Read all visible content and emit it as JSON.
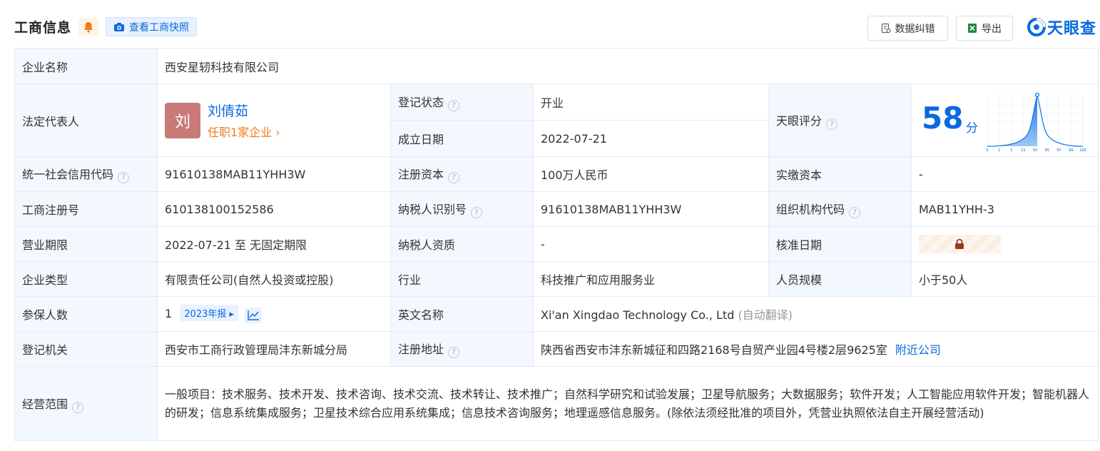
{
  "header": {
    "title": "工商信息",
    "snapshot_label": "查看工商快照",
    "correct_label": "数据纠错",
    "export_label": "导出",
    "logo_text": "天眼查"
  },
  "labels": {
    "company_name": "企业名称",
    "legal_rep": "法定代表人",
    "reg_status": "登记状态",
    "found_date": "成立日期",
    "tianyan_score": "天眼评分",
    "credit_code": "统一社会信用代码",
    "reg_capital": "注册资本",
    "paid_capital": "实缴资本",
    "reg_number": "工商注册号",
    "taxpayer_id": "纳税人识别号",
    "org_code": "组织机构代码",
    "term": "营业期限",
    "taxpayer_quality": "纳税人资质",
    "approval_date": "核准日期",
    "company_type": "企业类型",
    "industry": "行业",
    "staff_size": "人员规模",
    "insured_count": "参保人数",
    "english_name": "英文名称",
    "reg_authority": "登记机关",
    "reg_address": "注册地址",
    "business_scope": "经营范围"
  },
  "values": {
    "company_name": "西安星轫科技有限公司",
    "rep_avatar": "刘",
    "rep_name": "刘倩茹",
    "rep_sub": "任职1家企业",
    "reg_status": "开业",
    "found_date": "2022-07-21",
    "score": "58",
    "score_unit": "分",
    "credit_code": "91610138MAB11YHH3W",
    "reg_capital": "100万人民币",
    "paid_capital": "-",
    "reg_number": "610138100152586",
    "taxpayer_id": "91610138MAB11YHH3W",
    "org_code": "MAB11YHH-3",
    "term": "2022-07-21 至 无固定期限",
    "taxpayer_quality": "-",
    "company_type": "有限责任公司(自然人投资或控股)",
    "industry": "科技推广和应用服务业",
    "staff_size": "小于50人",
    "insured_count": "1",
    "insured_report": "2023年报",
    "english_name": "Xi'an Xingdao Technology Co., Ltd",
    "english_note": "(自动翻译)",
    "reg_authority": "西安市工商行政管理局沣东新城分局",
    "reg_address": "陕西省西安市沣东新城征和四路2168号自贸产业园4号楼2层9625室",
    "nearby_link": "附近公司",
    "business_scope": "一般项目：技术服务、技术开发、技术咨询、技术交流、技术转让、技术推广；自然科学研究和试验发展；卫星导航服务；大数据服务；软件开发；人工智能应用软件开发；智能机器人的研发；信息系统集成服务；卫星技术综合应用系统集成；信息技术咨询服务；地理遥感信息服务。(除依法须经批准的项目外，凭营业执照依法自主开展经营活动)"
  },
  "score_axis": [
    "0",
    "1",
    "3",
    "15",
    "50",
    "85",
    "97",
    "99",
    "100"
  ],
  "colors": {
    "accent": "#0a6ae0",
    "label_bg": "#f2f8fe",
    "status_green": "#1a9a3e",
    "orange": "#f07a1a"
  }
}
